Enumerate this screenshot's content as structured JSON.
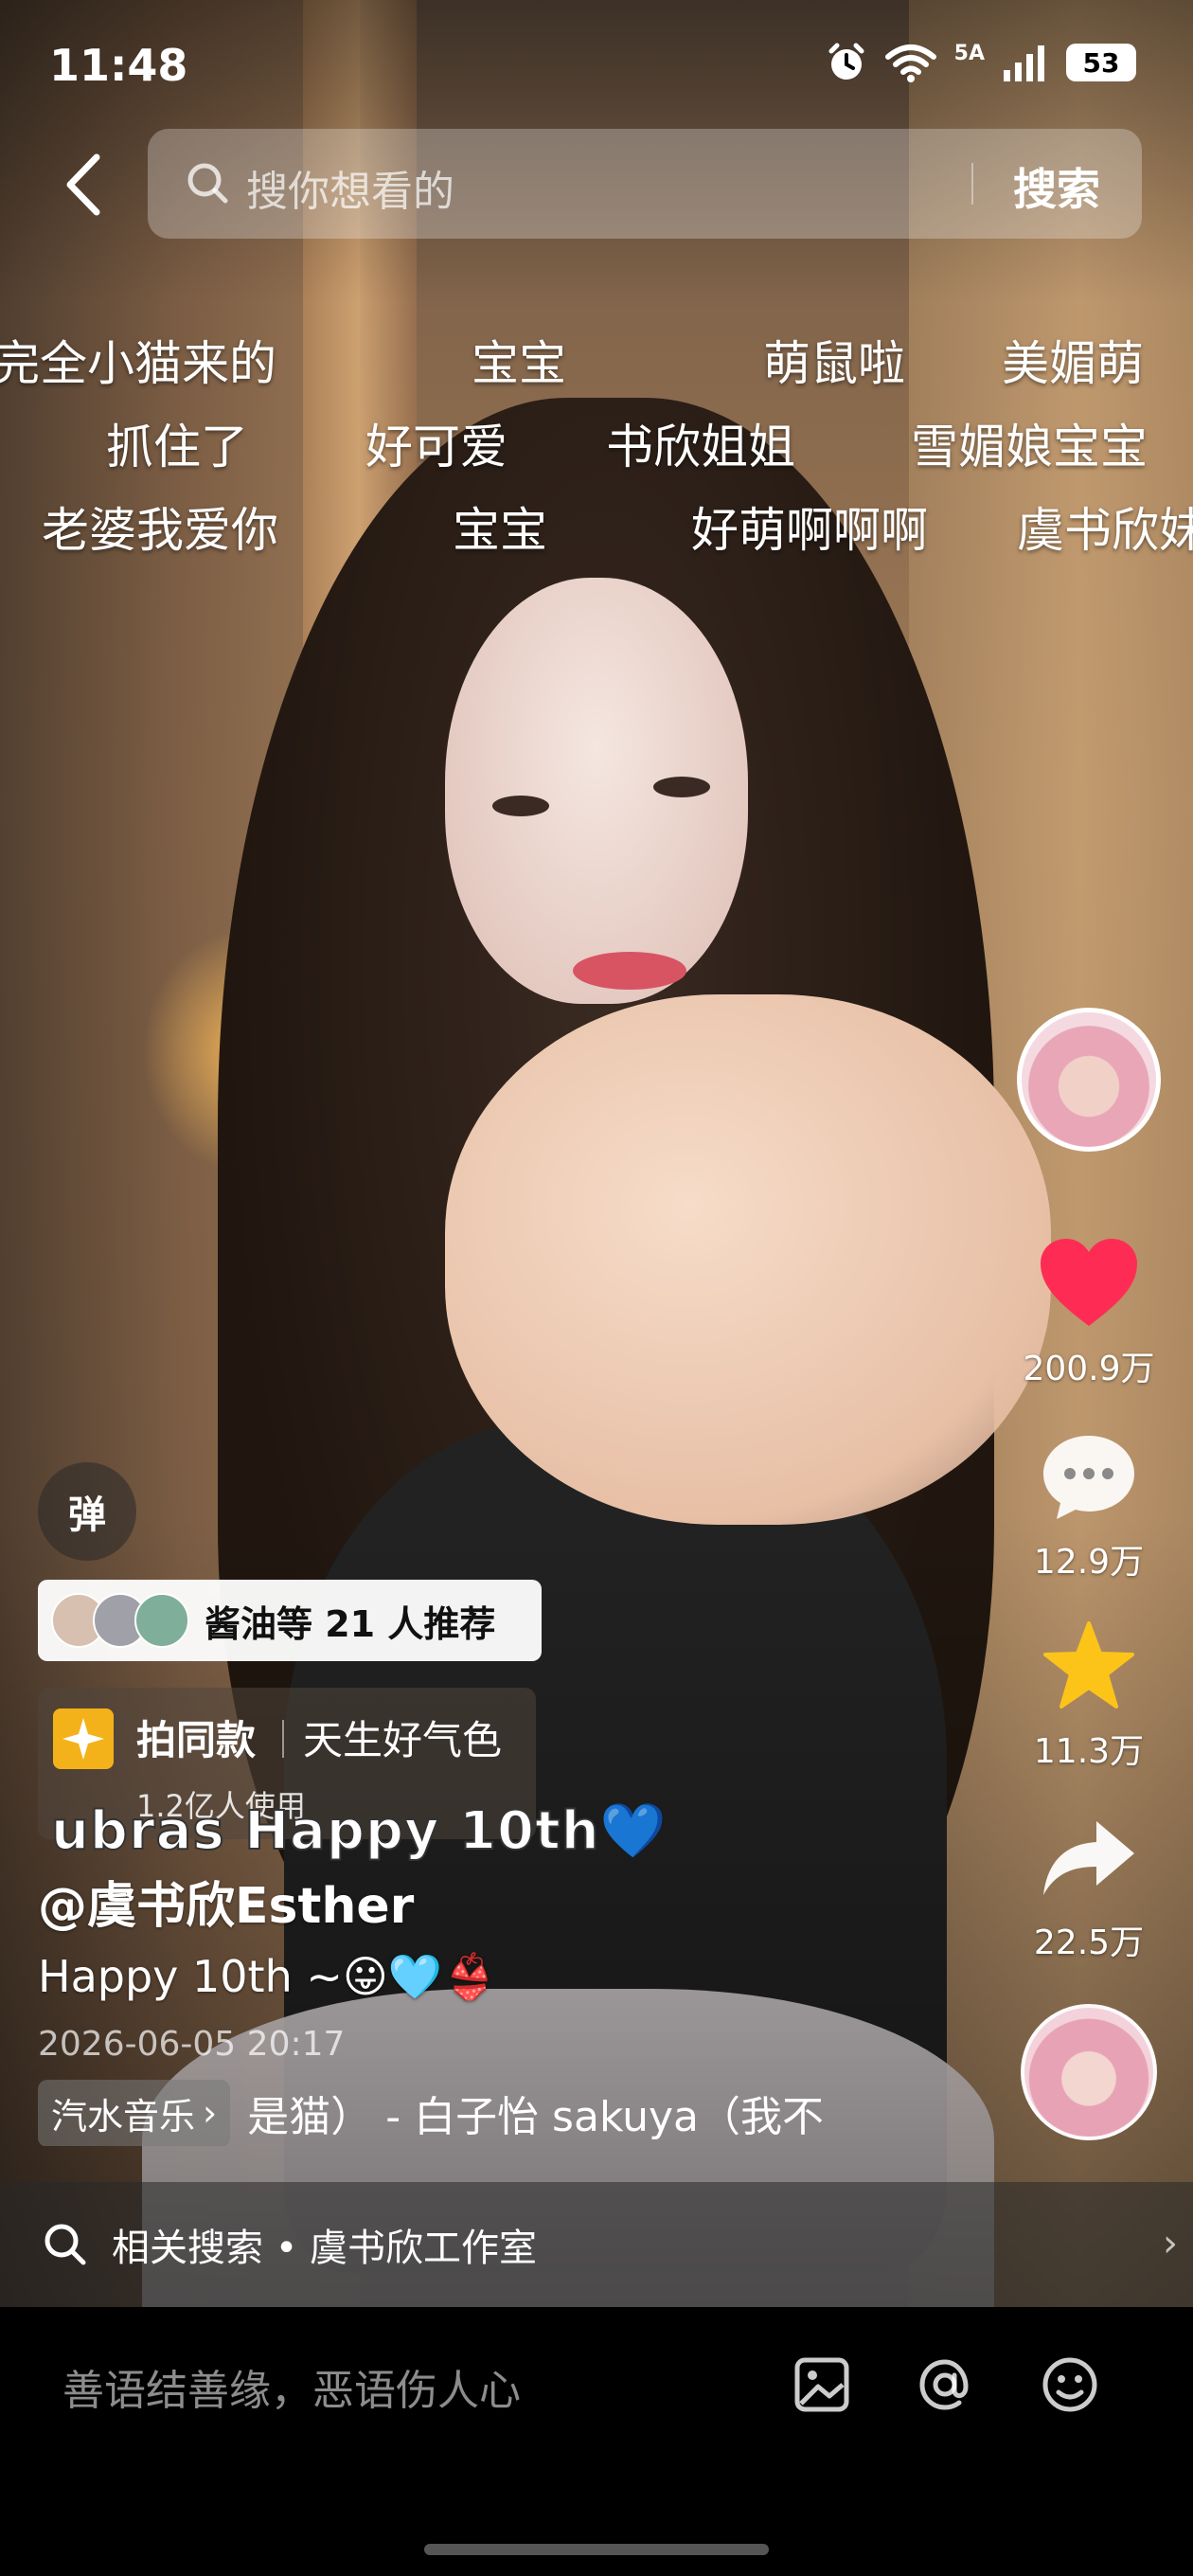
{
  "status_bar": {
    "time": "11:48",
    "network": "5A",
    "battery": "53"
  },
  "search": {
    "placeholder": "搜你想看的",
    "button": "搜索"
  },
  "danmaku": [
    "完全小猫来的",
    "宝宝",
    "萌鼠啦",
    "美媚萌",
    "抓住了",
    "好可爱",
    "书欣姐姐",
    "雪媚娘宝宝",
    "老婆我爱你",
    "宝宝",
    "好萌啊啊啊",
    "虞书欣妹"
  ],
  "rail": {
    "like_count": "200.9万",
    "comment_count": "12.9万",
    "favorite_count": "11.3万",
    "share_count": "22.5万"
  },
  "overlay": {
    "danmu_toggle": "弹",
    "recommend": "酱油等 21 人推荐",
    "same_style_label": "拍同款",
    "same_style_name": "天生好气色",
    "same_style_usage": "1.2亿人使用",
    "sticker_text": "ubras Happy 10th💙",
    "author": "@虞书欣Esther",
    "caption": "Happy 10th ~😛🩵👙",
    "date": "2026-06-05 20:17",
    "music_tag": "汽水音乐",
    "music_title": "是猫） - 白子怡 sakuya（我不"
  },
  "related": {
    "text": "相关搜索 • 虞书欣工作室"
  },
  "comment_bar": {
    "placeholder": "善语结善缘，恶语伤人心"
  },
  "colors": {
    "like": "#fe2c55",
    "favorite": "#fcc419"
  }
}
